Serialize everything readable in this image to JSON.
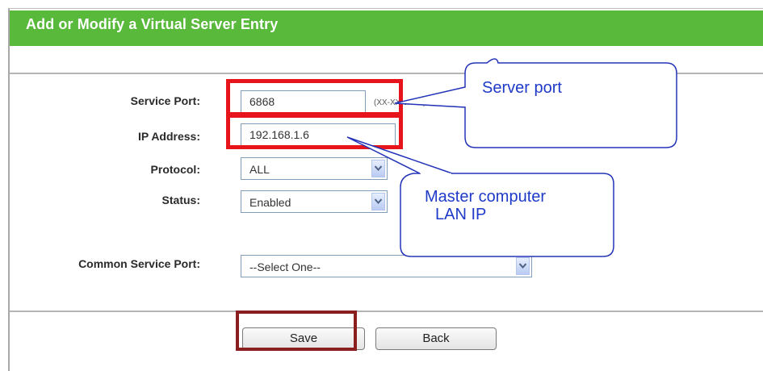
{
  "header": {
    "title": "Add or Modify a Virtual Server Entry"
  },
  "form": {
    "service_port": {
      "label": "Service Port:",
      "value": "6868"
    },
    "ip_address": {
      "label": "IP Address:",
      "value": "192.168.1.6"
    },
    "protocol": {
      "label": "Protocol:",
      "value": "ALL"
    },
    "status": {
      "label": "Status:",
      "value": "Enabled"
    },
    "common_service_port": {
      "label": "Common Service Port:",
      "value": "--Select One--"
    }
  },
  "buttons": {
    "save": "Save",
    "back": "Back"
  },
  "annotations": {
    "server_port": "Server port",
    "master_line1": "Master computer",
    "master_line2": "LAN IP"
  },
  "colors": {
    "header": "#58b93b",
    "highlight_red": "#e8141c",
    "highlight_dark": "#8b1f1f",
    "callout_text": "#1f3ac8"
  }
}
